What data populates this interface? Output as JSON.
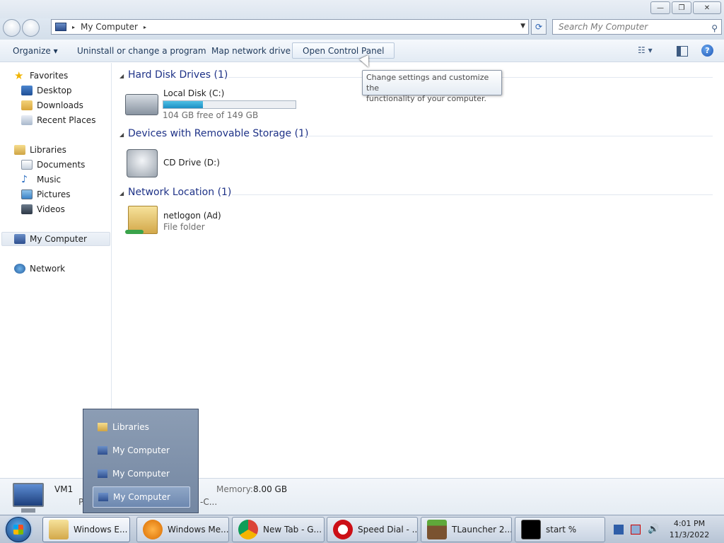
{
  "window": {
    "minimize_glyph": "—",
    "maximize_glyph": "❐",
    "close_glyph": "✕"
  },
  "address": {
    "crumb": "My Computer",
    "sep": "▸",
    "drop": "▼",
    "search_placeholder": "Search My Computer",
    "refresh_glyph": "⟳",
    "search_glyph": "⚲"
  },
  "toolbar": {
    "organize": "Organize ▾",
    "uninstall": "Uninstall or change a program",
    "map_drive": "Map network drive",
    "control_panel": "Open Control Panel",
    "views_glyph": "☷ ▾",
    "help_glyph": "?"
  },
  "nav": {
    "favorites": "Favorites",
    "desktop": "Desktop",
    "downloads": "Downloads",
    "recent": "Recent Places",
    "libraries": "Libraries",
    "documents": "Documents",
    "music": "Music",
    "pictures": "Pictures",
    "videos": "Videos",
    "computer": "My Computer",
    "network": "Network"
  },
  "groups": {
    "hdd": "Hard Disk Drives (1)",
    "removable": "Devices with Removable Storage (1)",
    "network": "Network Location (1)",
    "collapse_glyph": "◢"
  },
  "drives": {
    "c_name": "Local Disk (C:)",
    "c_free": "104 GB free of 149 GB",
    "c_used_fraction": 0.3,
    "d_name": "CD Drive (D:)",
    "net_name": "netlogon (Ad)",
    "net_type": "File folder"
  },
  "tooltip": {
    "line1": "Change settings and customize the",
    "line2": "functionality of your computer."
  },
  "details": {
    "name": "VM1",
    "memory_label": "Memory:",
    "memory_value": "8.00 GB",
    "frag_p": "P",
    "frag_c": "-C..."
  },
  "popup": {
    "items": [
      "Libraries",
      "My Computer",
      "My Computer",
      "My Computer"
    ]
  },
  "taskbar": {
    "tasks": [
      "Windows E...",
      "Windows Me...",
      "New Tab - G...",
      "Speed Dial - ...",
      "TLauncher 2....",
      "start  %"
    ],
    "time": "4:01 PM",
    "date": "11/3/2022"
  },
  "colors": {
    "group_title": "#1e3287",
    "link_blue": "#1e395b",
    "progress": "#1d8fc4"
  }
}
